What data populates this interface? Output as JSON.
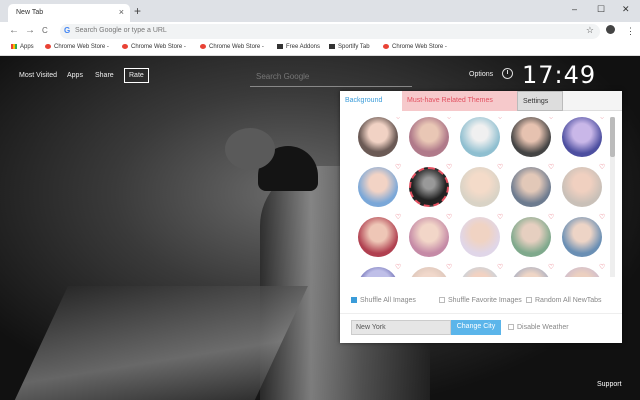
{
  "browser": {
    "tab_title": "New Tab",
    "tab_close": "×",
    "new_tab": "+",
    "win_min": "–",
    "win_max": "☐",
    "win_close": "✕",
    "nav_back": "←",
    "nav_forward": "→",
    "nav_reload": "C",
    "omnibox_g": "G",
    "omnibox_placeholder": "Search Google or type a URL",
    "star": "☆",
    "menu": "⋮",
    "bookmarks": [
      "Apps",
      "Chrome Web Store -",
      "Chrome Web Store -",
      "Chrome Web Store -",
      "Free Addons",
      "Sportify Tab",
      "Chrome Web Store -"
    ]
  },
  "page": {
    "nav": {
      "most_visited": "Most Visited",
      "apps": "Apps",
      "share": "Share",
      "rate": "Rate"
    },
    "search_placeholder": "Search Google",
    "options": "Options",
    "clock": "17:49",
    "support": "Support"
  },
  "panel": {
    "tabs": {
      "background": "Background",
      "related": "Must-have Related Themes",
      "settings": "Settings"
    },
    "heart": "♡",
    "options": {
      "shuffle_all": "Shuffle All Images",
      "shuffle_fav": "Shuffle Favorite Images",
      "random_all": "Random All NewTabs"
    },
    "city_value": "New York",
    "change_city": "Change City",
    "disable_weather": "Disable Weather"
  },
  "colors": {
    "accent_blue": "#3b9cd9",
    "accent_pink": "#e25060"
  }
}
